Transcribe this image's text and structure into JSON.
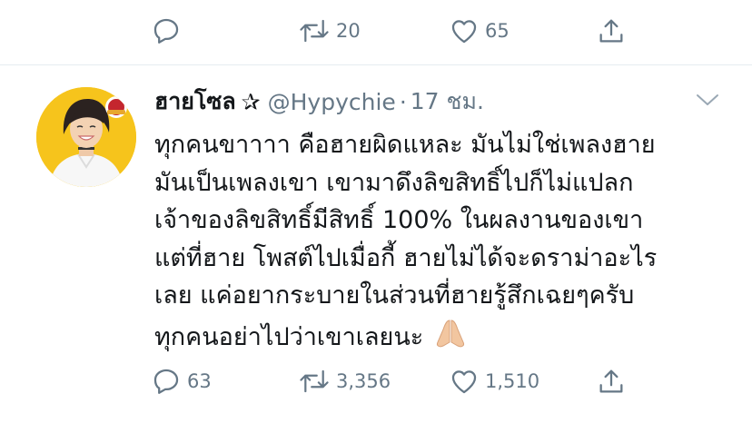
{
  "previous_tweet": {
    "reply_count": "",
    "retweet_count": "20",
    "like_count": "65"
  },
  "tweet": {
    "display_name": "ฮายโซล",
    "name_badge": "✰",
    "handle": "@Hypychie",
    "separator": "·",
    "time": "17 ชม.",
    "text_lines": [
      "ทุกคนขาาาา คือฮายผิดแหละ มันไม่ใช่เพลงฮาย",
      "มันเป็นเพลงเขา เขามาดึงลิขสิทธิ์ไปก็ไม่แปลก",
      "เจ้าของลิขสิทธิ์มีสิทธิ์ 100% ในผลงานของเขา",
      "แต่ที่ฮาย โพสต์ไปเมื่อกี้ ฮายไม่ได้จะดราม่าอะไร",
      "เลย แค่อยากระบายในส่วนที่ฮายรู้สึกเฉยๆครับ",
      "ทุกคนอย่าไปว่าเขาเลยนะ"
    ],
    "reply_count": "63",
    "retweet_count": "3,356",
    "like_count": "1,510"
  },
  "icons": {
    "reply": "reply-icon",
    "retweet": "retweet-icon",
    "like": "heart-icon",
    "share": "share-icon",
    "caret": "chevron-down-icon",
    "emoji": "folded-hands-icon"
  },
  "colors": {
    "icon_gray": "#657786",
    "text": "#14171a",
    "divider": "#e6ecf0",
    "avatar_bg": "#f6c41c"
  }
}
